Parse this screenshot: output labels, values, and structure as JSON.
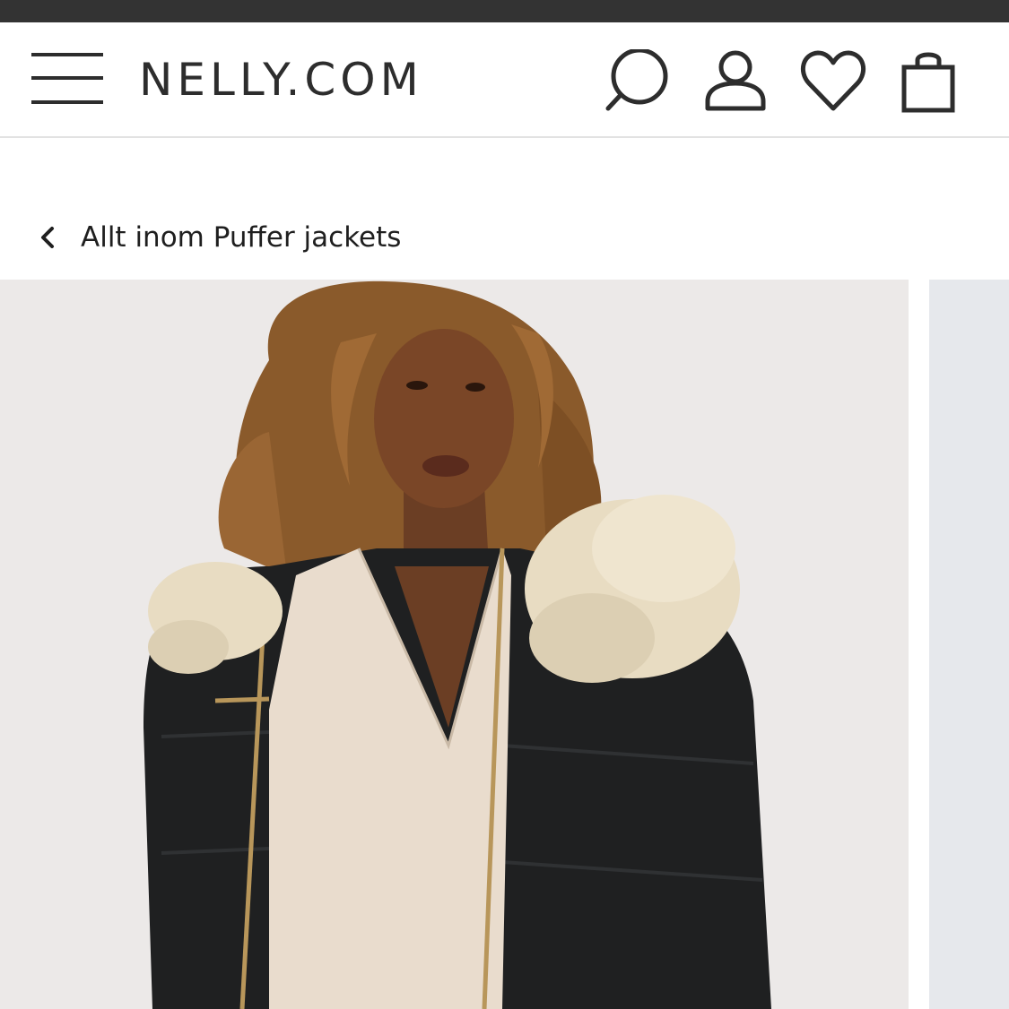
{
  "header": {
    "logo": "NELLY.COM",
    "icons": [
      "menu-icon",
      "search-icon",
      "account-icon",
      "heart-icon",
      "shopping-bag-icon"
    ]
  },
  "breadcrumb": {
    "label": "Allt inom Puffer jackets",
    "icon": "chevron-left-icon"
  },
  "gallery": {
    "images": [
      {
        "alt": "Model wearing black puffer jacket with fur hood"
      }
    ]
  },
  "colors": {
    "status_strip": "#333333",
    "text": "#2d2d2d",
    "divider": "#e2e2e2",
    "image_bg": "#ece9e8",
    "jacket": "#1f2021",
    "fur": "#e8dcc2"
  }
}
